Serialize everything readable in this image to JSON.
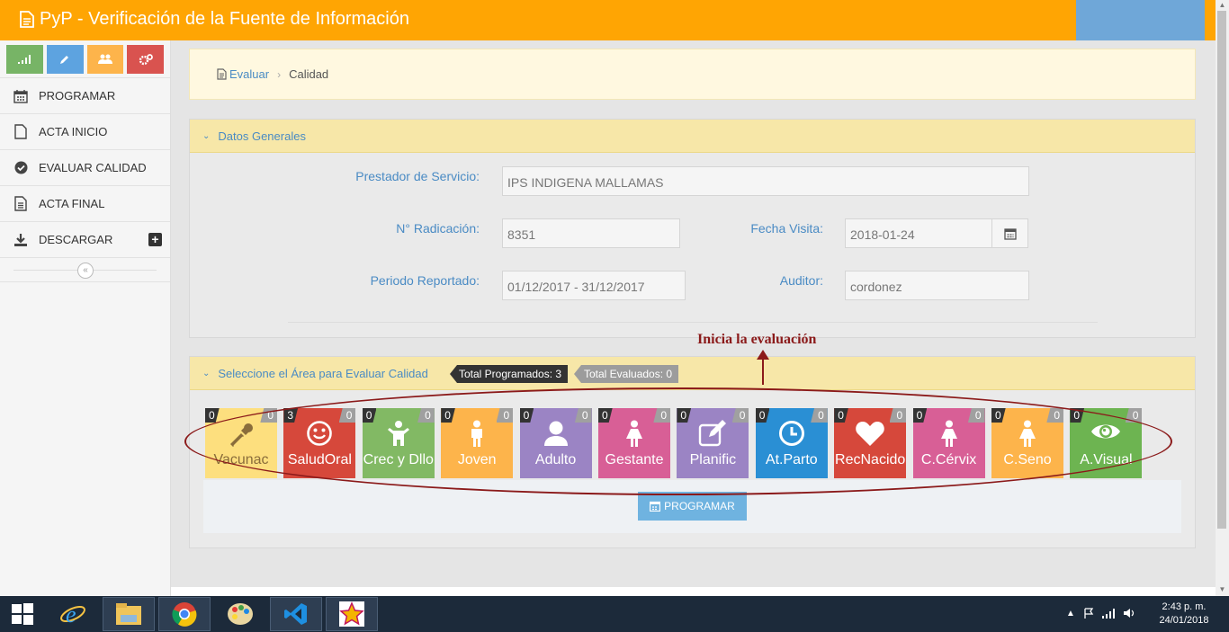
{
  "header": {
    "title": "PyP - Verificación de la Fuente de Información",
    "icon": "document-icon"
  },
  "sidebar": {
    "shortcuts": [
      {
        "icon": "signal-icon",
        "color": "#77b466"
      },
      {
        "icon": "pencil-icon",
        "color": "#5da3e0"
      },
      {
        "icon": "users-icon",
        "color": "#fdb44b"
      },
      {
        "icon": "cogs-icon",
        "color": "#d9534f"
      }
    ],
    "items": [
      {
        "label": "PROGRAMAR",
        "icon": "calendar-icon"
      },
      {
        "label": "ACTA INICIO",
        "icon": "file-icon"
      },
      {
        "label": "EVALUAR CALIDAD",
        "icon": "check-circle-icon"
      },
      {
        "label": "ACTA FINAL",
        "icon": "file-text-icon"
      },
      {
        "label": "DESCARGAR",
        "icon": "download-icon"
      }
    ]
  },
  "breadcrumb": {
    "link": "Evaluar",
    "current": "Calidad"
  },
  "general": {
    "title": "Datos Generales",
    "prestador_label": "Prestador de Servicio:",
    "prestador_value": "IPS INDIGENA MALLAMAS",
    "radicacion_label": "N° Radicación:",
    "radicacion_value": "8351",
    "fecha_label": "Fecha Visita:",
    "fecha_value": "2018-01-24",
    "periodo_label": "Periodo Reportado:",
    "periodo_value": "01/12/2017 - 31/12/2017",
    "auditor_label": "Auditor:",
    "auditor_value": "cordonez"
  },
  "areas": {
    "title": "Seleccione el Área para Evaluar Calidad",
    "total_programados": "Total Programados: 3",
    "total_evaluados": "Total Evaluados: 0",
    "button": "PROGRAMAR",
    "tiles": [
      {
        "label": "Vacunac",
        "left": "0",
        "right": "0",
        "color": "#fddf7e",
        "text": "#8a6d3b",
        "icon": "dropper-icon"
      },
      {
        "label": "SaludOral",
        "left": "3",
        "right": "0",
        "color": "#d6483b",
        "text": "#ffffff",
        "icon": "smile-icon"
      },
      {
        "label": "Crec y Dllo",
        "left": "0",
        "right": "0",
        "color": "#82b964",
        "text": "#ffffff",
        "icon": "child-icon"
      },
      {
        "label": "Joven",
        "left": "0",
        "right": "0",
        "color": "#fdb44b",
        "text": "#ffffff",
        "icon": "male-icon"
      },
      {
        "label": "Adulto",
        "left": "0",
        "right": "0",
        "color": "#9b84c4",
        "text": "#ffffff",
        "icon": "user-icon"
      },
      {
        "label": "Gestante",
        "left": "0",
        "right": "0",
        "color": "#d85f96",
        "text": "#ffffff",
        "icon": "female-icon"
      },
      {
        "label": "Planific",
        "left": "0",
        "right": "0",
        "color": "#9b84c4",
        "text": "#ffffff",
        "icon": "edit-icon"
      },
      {
        "label": "At.Parto",
        "left": "0",
        "right": "0",
        "color": "#2a8fd4",
        "text": "#ffffff",
        "icon": "clock-icon"
      },
      {
        "label": "RecNacido",
        "left": "0",
        "right": "0",
        "color": "#d6483b",
        "text": "#ffffff",
        "icon": "heart-icon"
      },
      {
        "label": "C.Cérvix",
        "left": "0",
        "right": "0",
        "color": "#d85f96",
        "text": "#ffffff",
        "icon": "female-icon"
      },
      {
        "label": "C.Seno",
        "left": "0",
        "right": "0",
        "color": "#fdb44b",
        "text": "#ffffff",
        "icon": "female-icon"
      },
      {
        "label": "A.Visual",
        "left": "0",
        "right": "0",
        "color": "#6db451",
        "text": "#ffffff",
        "icon": "eye-icon"
      }
    ]
  },
  "annotation": "Inicia la evaluación",
  "taskbar": {
    "time": "2:43 p. m.",
    "date": "24/01/2018"
  }
}
